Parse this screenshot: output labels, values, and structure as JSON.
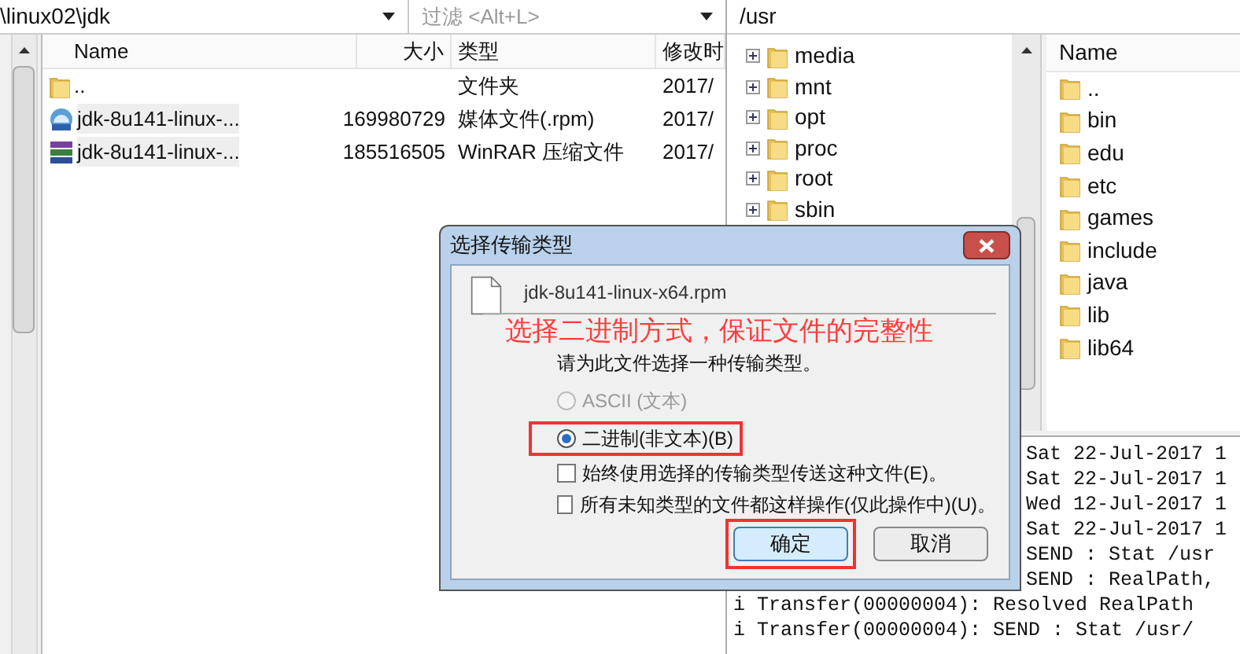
{
  "local": {
    "path": "\\linux02\\jdk",
    "filter": {
      "placeholder": "过滤 <Alt+L>"
    },
    "columns": [
      "Name",
      "大小",
      "类型",
      "修改时"
    ],
    "rows": [
      {
        "kind": "folder",
        "name": "..",
        "size": "",
        "type": "文件夹",
        "modified": "2017/"
      },
      {
        "kind": "media",
        "name": "jdk-8u141-linux-...",
        "size": "169980729",
        "type": "媒体文件(.rpm)",
        "modified": "2017/"
      },
      {
        "kind": "archive",
        "name": "jdk-8u141-linux-...",
        "size": "185516505",
        "type": "WinRAR 压缩文件",
        "modified": "2017/"
      }
    ]
  },
  "remote": {
    "path": "/usr",
    "tree": [
      {
        "name": "media",
        "expanded": false
      },
      {
        "name": "mnt",
        "expanded": false
      },
      {
        "name": "opt",
        "expanded": false
      },
      {
        "name": "proc",
        "expanded": false
      },
      {
        "name": "root",
        "expanded": false
      },
      {
        "name": "sbin",
        "expanded": false
      }
    ],
    "list_header": "Name",
    "items": [
      "..",
      "bin",
      "edu",
      "etc",
      "games",
      "include",
      "java",
      "lib",
      "lib64"
    ]
  },
  "log": {
    "covered_lines": [
      "Sat 22-Jul-2017 1",
      "Sat 22-Jul-2017 1",
      "Wed 12-Jul-2017 1",
      "Sat 22-Jul-2017 1",
      "SEND : Stat /usr",
      "SEND : RealPath,"
    ],
    "lines": [
      "i Transfer(00000004): Resolved RealPath",
      "i Transfer(00000004): SEND : Stat /usr/"
    ]
  },
  "dialog": {
    "title": "选择传输类型",
    "filename": "jdk-8u141-linux-x64.rpm",
    "annotation": "选择二进制方式，保证文件的完整性",
    "prompt": "请为此文件选择一种传输类型。",
    "options": [
      {
        "label": "ASCII (文本)",
        "selected": false,
        "disabled": true
      },
      {
        "label": "二进制(非文本)(B)",
        "selected": true,
        "disabled": false
      }
    ],
    "checkboxes": [
      {
        "label": "始终使用选择的传输类型传送这种文件(E)。",
        "checked": false
      },
      {
        "label": "所有未知类型的文件都这样操作(仅此操作中)(U)。",
        "checked": false
      }
    ],
    "buttons": [
      {
        "label": "确定",
        "default": true
      },
      {
        "label": "取消",
        "default": false
      }
    ]
  }
}
